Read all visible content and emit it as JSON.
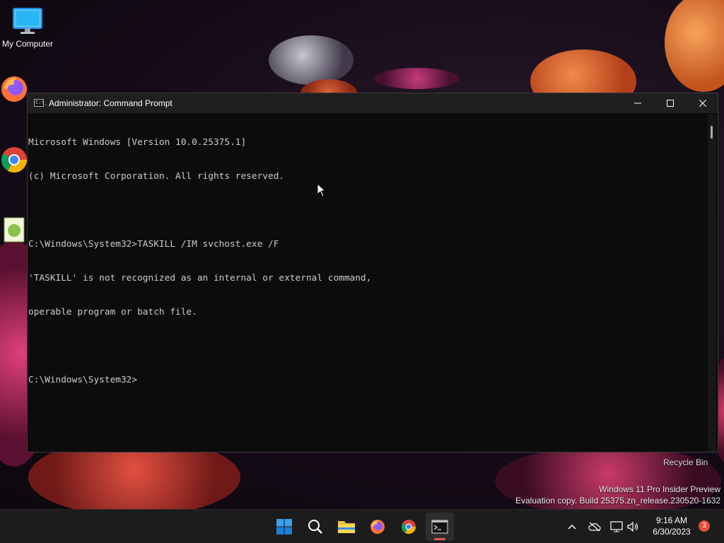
{
  "desktop": {
    "icons": [
      {
        "label": "My Computer"
      },
      {
        "label": "Firefox"
      },
      {
        "label": "Google Chrome"
      },
      {
        "label": "Notepad++"
      }
    ],
    "recycle_bin": "Recycle Bin",
    "watermark": {
      "line1": "Windows 11 Pro Insider Preview",
      "line2": "Evaluation copy. Build 25375.zn_release.230520-1632"
    }
  },
  "window": {
    "title": "Administrator: Command Prompt",
    "icon": "cmd-icon",
    "icon_text": "C:\\_",
    "console_lines": [
      "Microsoft Windows [Version 10.0.25375.1]",
      "(c) Microsoft Corporation. All rights reserved.",
      "",
      "C:\\Windows\\System32>TASKILL /IM svchost.exe /F",
      "'TASKILL' is not recognized as an internal or external command,",
      "operable program or batch file.",
      "",
      "C:\\Windows\\System32>"
    ]
  },
  "taskbar": {
    "apps": [
      "start-icon",
      "search-icon",
      "file-explorer-icon",
      "firefox-icon",
      "chrome-icon",
      "terminal-icon"
    ],
    "clock": {
      "time": "9:16 AM",
      "date": "6/30/2023"
    },
    "notification_count": "3"
  },
  "colors": {
    "console_bg": "#0c0c0c",
    "console_text": "#cccccc",
    "titlebar_bg": "#1f1f1f",
    "taskbar_bg": "#1c1c1c",
    "accent": "#0078d4"
  }
}
